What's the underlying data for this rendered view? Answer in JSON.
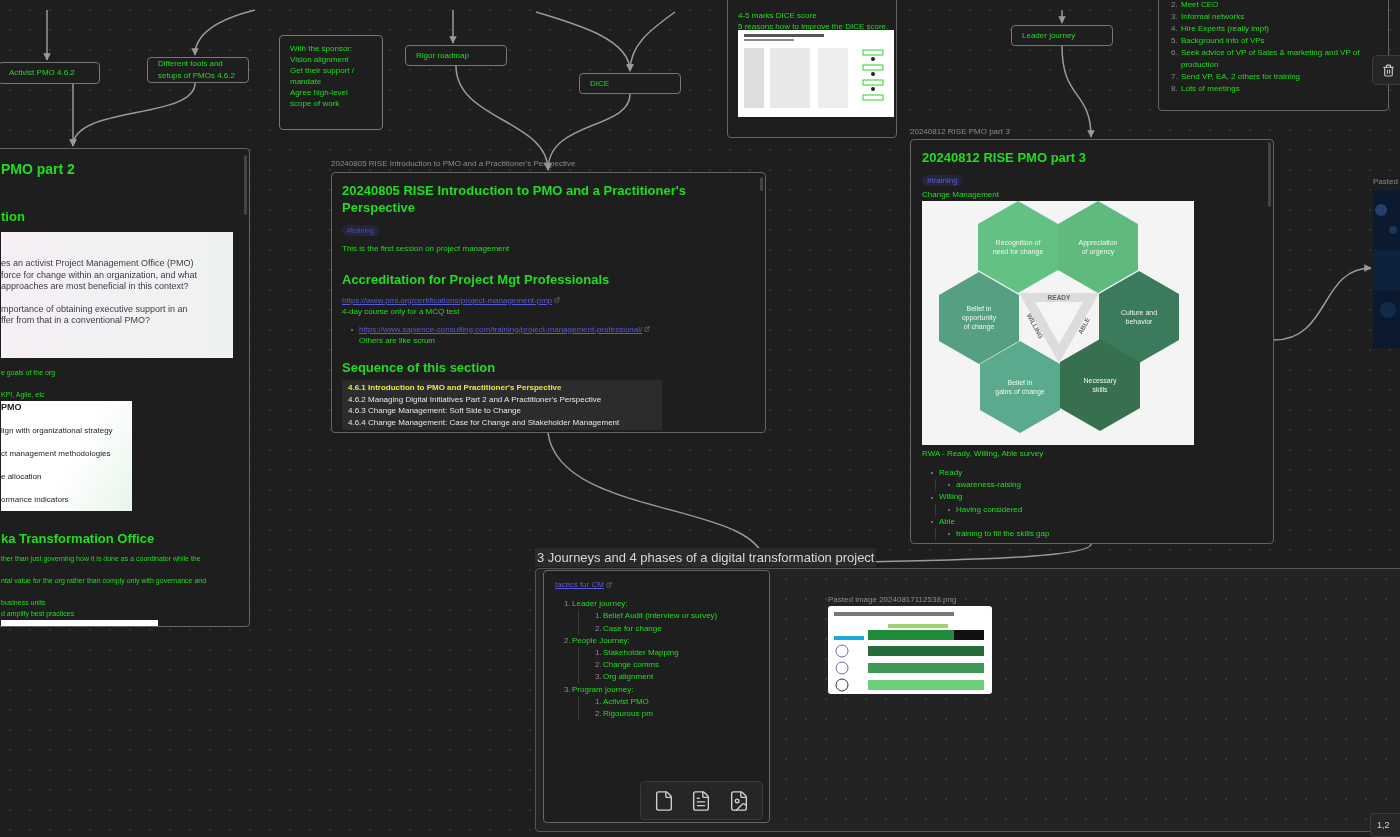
{
  "text_nodes": [
    {
      "text": "Activist PMO 4.6.2"
    },
    {
      "text": "Different tools and setups of PMOs 4.6.2"
    },
    {
      "text": "Rigor roadmap"
    },
    {
      "text": "DICE"
    },
    {
      "text": "Leader journey"
    }
  ],
  "sponsor_note": {
    "lines": [
      "With the sponsor:",
      "Vision alignment",
      "Get their support / mandate",
      "Agree high-level scope of work"
    ]
  },
  "dice_card": {
    "lines": [
      "4-5 marks DICE score",
      "5 reasons how to improve the DICE score."
    ]
  },
  "list_card": {
    "items": [
      {
        "number": "2.",
        "text": "Meet CEO"
      },
      {
        "number": "3.",
        "text": "Informal networks"
      },
      {
        "number": "4.",
        "text": "Hire Experts (really impt)"
      },
      {
        "number": "5.",
        "text": "Background info of VPs"
      },
      {
        "number": "6.",
        "text": "Seek advice of VP of Sales & marketing and VP of production"
      },
      {
        "number": "7.",
        "text": "Send VP, EA, 2 others for training"
      },
      {
        "number": "8.",
        "text": "Lots of meetings"
      }
    ]
  },
  "pmo2_card": {
    "title": "PMO part 2",
    "heading_1": "tion",
    "slide_1": {
      "lines": [
        "es an activist Project Management Office (PMO)",
        "force for change within an organization, and what",
        "approaches are most beneficial in this context?",
        "mportance of obtaining executive support in an",
        "ffer from that in a conventional PMO?"
      ]
    },
    "notes_1": [
      "e goals of the org",
      "KPI, Agile, etc"
    ],
    "slide_2": {
      "title": "PMO",
      "lines": [
        "lign with organizational strategy",
        "ct management methodologies",
        "e allocation",
        "ormance indicators"
      ]
    },
    "heading_2": "ka Transformation Office",
    "notes_2": [
      "ther than just governing how it is done as a coordinator while the",
      "ntal value for the org rather than comply only with governance and",
      "business units",
      "d amplify best practices"
    ]
  },
  "intro_card": {
    "label": "20240805 RISE Introduction to PMO and a Practitioner's Perspective",
    "title": "20240805 RISE Introduction to PMO and a Practitioner's Perspective",
    "tag": "#training",
    "intro": "This is the first session on project management",
    "heading_1": "Accreditation for Project Mgt Professionals",
    "link": "https://www.pmi.org/certifications/project-management-pmp",
    "note": "4-day course only for a MCQ test",
    "bullets": [
      {
        "link": "https://www.sapience-consulting.com/training/project-management-professional/",
        "note": "Others are like scrum"
      }
    ],
    "heading_2": "Sequence of this section",
    "sequence_rows": [
      {
        "text": "4.6.1 Introduction to PMO and Practitioner's Perspective",
        "highlighted": true
      },
      {
        "text": "4.6.2 Managing Digital Initiatives Part 2 and A Practitioner's Perspective",
        "highlighted": false
      },
      {
        "text": "4.6.3 Change Management: Soft Side to Change",
        "highlighted": false
      },
      {
        "text": "4.6.4 Change Management: Case for Change and Stakeholder Management",
        "highlighted": false
      }
    ]
  },
  "pmo3_card": {
    "label": "20240812 RISE PMO part 3",
    "title": "20240812 RISE PMO part 3",
    "tag": "#training",
    "subtitle": "Change Management",
    "hexagons": [
      {
        "lines": [
          "Recognition of",
          "need for change"
        ],
        "color": "#64c184"
      },
      {
        "lines": [
          "Appreciation",
          "of urgency"
        ],
        "color": "#5fba7d"
      },
      {
        "lines": [
          "Belief in",
          "opportunity",
          "of change"
        ],
        "color": "#55a082"
      },
      {
        "lines": [
          "Culture and",
          "behavior"
        ],
        "color": "#3b7a5a"
      },
      {
        "lines": [
          "Belief in",
          "gains of change"
        ],
        "color": "#5aab8e"
      },
      {
        "lines": [
          "Necessary",
          "skills"
        ],
        "color": "#37704f"
      }
    ],
    "triangle_labels": [
      "READY",
      "WILLING",
      "ABLE"
    ],
    "caption": "RWA - Ready, Willing, Able survey",
    "items": [
      {
        "text": "Ready",
        "children": [
          {
            "text": "awareness-raising"
          }
        ]
      },
      {
        "text": "Willing",
        "children": [
          {
            "text": "Having considered"
          }
        ]
      },
      {
        "text": "Able",
        "children": [
          {
            "text": "training to fill the skills gap"
          }
        ]
      }
    ]
  },
  "pasted_node": {
    "label": "Pasted"
  },
  "group": {
    "label": "3 Journeys and 4 phases of a digital transformation project",
    "link": "tactics for CM",
    "items": [
      {
        "number": "1.",
        "text": "Leader journey:",
        "children": [
          {
            "number": "1.",
            "text": "Belief Audit (interview or survey)"
          },
          {
            "number": "2.",
            "text": "Case for change"
          }
        ]
      },
      {
        "number": "2.",
        "text": "People Journey:",
        "children": [
          {
            "number": "1.",
            "text": "Stakeholder Mapping"
          },
          {
            "number": "2.",
            "text": "Change comms"
          },
          {
            "number": "3.",
            "text": "Org alignment"
          }
        ]
      },
      {
        "number": "3.",
        "text": "Program journey:",
        "children": [
          {
            "number": "1.",
            "text": "Activist PMO"
          },
          {
            "number": "2.",
            "text": "Rigourous pm"
          }
        ]
      }
    ],
    "image_label": "Pasted image 20240817112538.png"
  },
  "zoom_indicator": "1,2"
}
